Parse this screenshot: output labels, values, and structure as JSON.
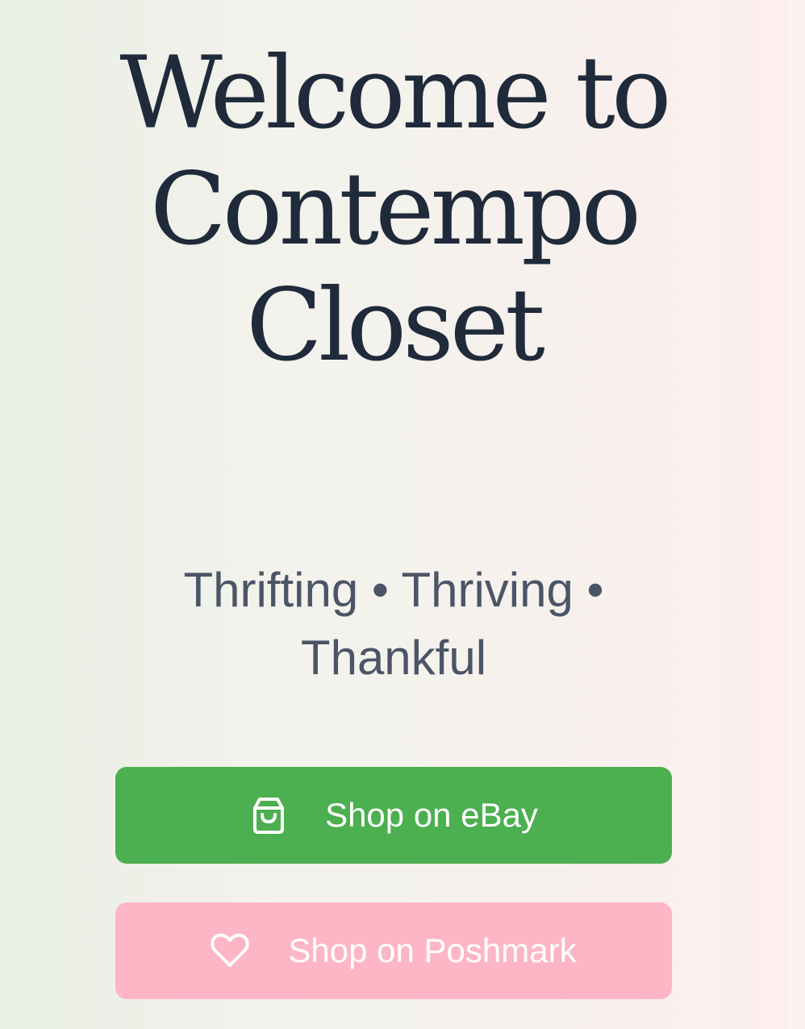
{
  "hero": {
    "title": "Welcome to Contempo Closet",
    "tagline": "Thrifting • Thriving • Thankful"
  },
  "buttons": {
    "ebay": {
      "label": "Shop on eBay",
      "icon": "shopping-bag-icon",
      "color": "#4caf50"
    },
    "poshmark": {
      "label": "Shop on Poshmark",
      "icon": "heart-icon",
      "color": "#fdb6c6"
    }
  },
  "colors": {
    "title_text": "#1f2a3a",
    "tagline_text": "#4b5567",
    "button_text": "#ffffff"
  }
}
